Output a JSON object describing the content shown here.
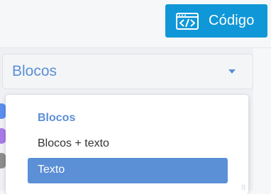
{
  "toolbar": {
    "code_button_label": "Código",
    "code_icon": "code-window-icon",
    "accent_color": "#0f97d8"
  },
  "block_select": {
    "value": "Blocos",
    "caret_icon": "caret-down-icon",
    "text_color": "#5b8fd6"
  },
  "dropdown": {
    "group_label": "Blocos",
    "options": [
      {
        "label": "Blocos + texto",
        "selected": false
      },
      {
        "label": "Texto",
        "selected": true
      }
    ],
    "selected_color": "#5b8fd6"
  }
}
